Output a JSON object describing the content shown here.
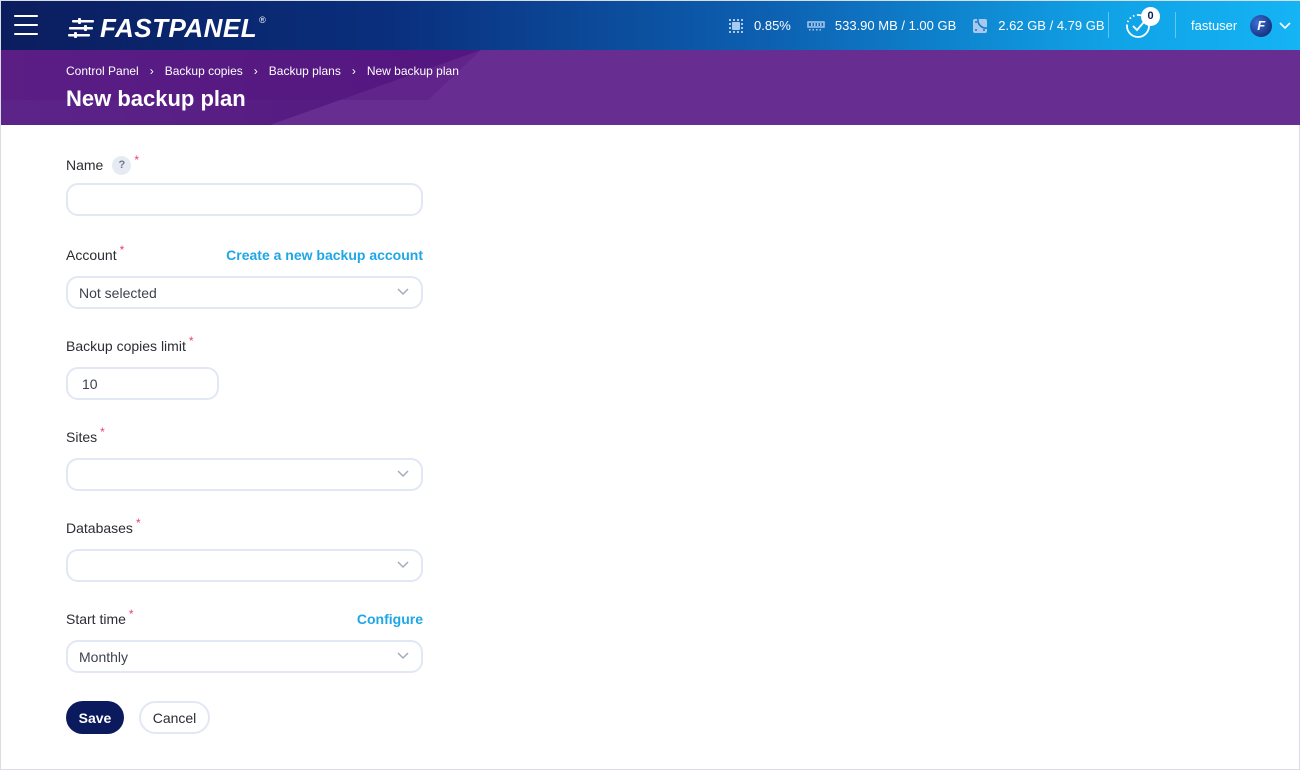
{
  "topbar": {
    "logo_text": "FASTPANEL",
    "logo_reg": "®",
    "stats": {
      "cpu": "0.85%",
      "ram": "533.90 MB / 1.00 GB",
      "disk": "2.62 GB / 4.79 GB"
    },
    "tasks_count": "0",
    "username": "fastuser",
    "avatar_letter": "F"
  },
  "header": {
    "breadcrumb": [
      "Control Panel",
      "Backup copies",
      "Backup plans",
      "New backup plan"
    ],
    "title": "New backup plan"
  },
  "form": {
    "name": {
      "label": "Name",
      "help": "?",
      "value": ""
    },
    "account": {
      "label": "Account",
      "link": "Create a new backup account",
      "value": "Not selected"
    },
    "limit": {
      "label": "Backup copies limit",
      "value": "10"
    },
    "sites": {
      "label": "Sites",
      "value": ""
    },
    "databases": {
      "label": "Databases",
      "value": ""
    },
    "start_time": {
      "label": "Start time",
      "link": "Configure",
      "value": "Monthly"
    },
    "required_mark": "*"
  },
  "actions": {
    "save": "Save",
    "cancel": "Cancel"
  },
  "colors": {
    "accent_link": "#1ea7e6",
    "primary_button": "#0b1a5c",
    "header_purple": "#672d91",
    "required": "#e8436b"
  }
}
